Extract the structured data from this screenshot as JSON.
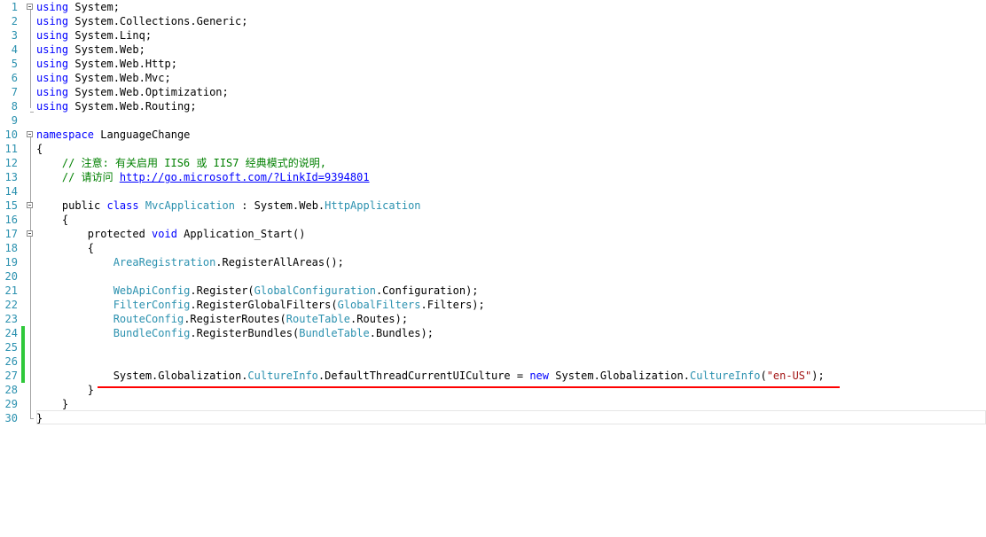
{
  "editor": {
    "lines": [
      {
        "n": "1",
        "parts": [
          {
            "t": "using",
            "c": "kw"
          },
          {
            "t": " System;"
          }
        ]
      },
      {
        "n": "2",
        "parts": [
          {
            "t": "using",
            "c": "kw"
          },
          {
            "t": " System.Collections.Generic;"
          }
        ]
      },
      {
        "n": "3",
        "parts": [
          {
            "t": "using",
            "c": "kw"
          },
          {
            "t": " System.Linq;"
          }
        ]
      },
      {
        "n": "4",
        "parts": [
          {
            "t": "using",
            "c": "kw"
          },
          {
            "t": " System.Web;"
          }
        ]
      },
      {
        "n": "5",
        "parts": [
          {
            "t": "using",
            "c": "kw"
          },
          {
            "t": " System.Web.Http;"
          }
        ]
      },
      {
        "n": "6",
        "parts": [
          {
            "t": "using",
            "c": "kw"
          },
          {
            "t": " System.Web.Mvc;"
          }
        ]
      },
      {
        "n": "7",
        "parts": [
          {
            "t": "using",
            "c": "kw"
          },
          {
            "t": " System.Web.Optimization;"
          }
        ]
      },
      {
        "n": "8",
        "parts": [
          {
            "t": "using",
            "c": "kw"
          },
          {
            "t": " System.Web.Routing;"
          }
        ]
      },
      {
        "n": "9",
        "parts": []
      },
      {
        "n": "10",
        "parts": [
          {
            "t": "namespace",
            "c": "kw"
          },
          {
            "t": " LanguageChange"
          }
        ]
      },
      {
        "n": "11",
        "parts": [
          {
            "t": "{"
          }
        ]
      },
      {
        "n": "12",
        "parts": [
          {
            "t": "    "
          },
          {
            "t": "// 注意: 有关启用 IIS6 或 IIS7 经典模式的说明,",
            "c": "cm"
          }
        ]
      },
      {
        "n": "13",
        "parts": [
          {
            "t": "    "
          },
          {
            "t": "// 请访问 ",
            "c": "cm"
          },
          {
            "t": "http://go.microsoft.com/?LinkId=9394801",
            "c": "lk"
          }
        ]
      },
      {
        "n": "14",
        "parts": []
      },
      {
        "n": "15",
        "parts": [
          {
            "t": "    public ",
            "c": ""
          },
          {
            "t": "class",
            "c": "kw"
          },
          {
            "t": " "
          },
          {
            "t": "MvcApplication",
            "c": "ty"
          },
          {
            "t": " : System.Web."
          },
          {
            "t": "HttpApplication",
            "c": "ty"
          }
        ]
      },
      {
        "n": "16",
        "parts": [
          {
            "t": "    {"
          }
        ]
      },
      {
        "n": "17",
        "parts": [
          {
            "t": "        protected ",
            "c": ""
          },
          {
            "t": "void",
            "c": "kw"
          },
          {
            "t": " Application_Start()"
          }
        ]
      },
      {
        "n": "18",
        "parts": [
          {
            "t": "        {"
          }
        ]
      },
      {
        "n": "19",
        "parts": [
          {
            "t": "            "
          },
          {
            "t": "AreaRegistration",
            "c": "ty"
          },
          {
            "t": ".RegisterAllAreas();"
          }
        ]
      },
      {
        "n": "20",
        "parts": []
      },
      {
        "n": "21",
        "parts": [
          {
            "t": "            "
          },
          {
            "t": "WebApiConfig",
            "c": "ty"
          },
          {
            "t": ".Register("
          },
          {
            "t": "GlobalConfiguration",
            "c": "ty"
          },
          {
            "t": ".Configuration);"
          }
        ]
      },
      {
        "n": "22",
        "parts": [
          {
            "t": "            "
          },
          {
            "t": "FilterConfig",
            "c": "ty"
          },
          {
            "t": ".RegisterGlobalFilters("
          },
          {
            "t": "GlobalFilters",
            "c": "ty"
          },
          {
            "t": ".Filters);"
          }
        ]
      },
      {
        "n": "23",
        "parts": [
          {
            "t": "            "
          },
          {
            "t": "RouteConfig",
            "c": "ty"
          },
          {
            "t": ".RegisterRoutes("
          },
          {
            "t": "RouteTable",
            "c": "ty"
          },
          {
            "t": ".Routes);"
          }
        ]
      },
      {
        "n": "24",
        "parts": [
          {
            "t": "            "
          },
          {
            "t": "BundleConfig",
            "c": "ty"
          },
          {
            "t": ".RegisterBundles("
          },
          {
            "t": "BundleTable",
            "c": "ty"
          },
          {
            "t": ".Bundles);"
          }
        ]
      },
      {
        "n": "25",
        "parts": []
      },
      {
        "n": "26",
        "parts": []
      },
      {
        "n": "27",
        "parts": [
          {
            "t": "            System.Globalization."
          },
          {
            "t": "CultureInfo",
            "c": "ty"
          },
          {
            "t": ".DefaultThreadCurrentUICulture = "
          },
          {
            "t": "new",
            "c": "kw"
          },
          {
            "t": " System.Globalization."
          },
          {
            "t": "CultureInfo",
            "c": "ty"
          },
          {
            "t": "("
          },
          {
            "t": "\"en-US\"",
            "c": "st"
          },
          {
            "t": ");"
          }
        ]
      },
      {
        "n": "28",
        "parts": [
          {
            "t": "        }"
          }
        ]
      },
      {
        "n": "29",
        "parts": [
          {
            "t": "    }"
          }
        ]
      },
      {
        "n": "30",
        "parts": [
          {
            "t": "}"
          }
        ]
      }
    ],
    "folds": [
      "1",
      "10",
      "15",
      "17"
    ],
    "changed_lines": [
      "24",
      "25",
      "26",
      "27"
    ],
    "colors": {
      "keyword": "#0000ff",
      "type": "#2b91af",
      "comment": "#008000",
      "string": "#a31515",
      "line_number": "#2b91af",
      "change_bar": "#2fc83a",
      "annotation": "#ff0000"
    }
  }
}
